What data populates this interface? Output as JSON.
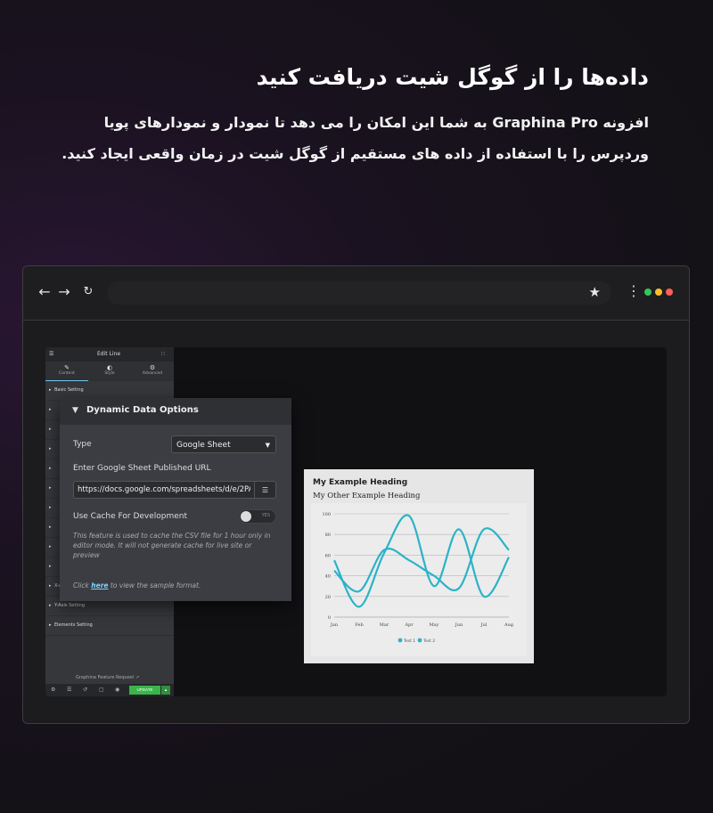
{
  "hero": {
    "title": "داده‌ها را از گوگل شیت دریافت کنید",
    "line1": "افزونه Graphina Pro به شما این امکان را می دهد تا نمودار و نمودارهای پویا",
    "line2": "وردپرس را با استفاده از داده های مستقیم از گوگل شیت در زمان واقعی ایجاد کنید."
  },
  "browser": {
    "url_value": "",
    "dot_colors": [
      "#34c759",
      "#ffbd2e",
      "#ff5f57"
    ]
  },
  "editor": {
    "title": "Edit Line",
    "tabs": [
      {
        "label": "Content",
        "icon": "pencil-icon"
      },
      {
        "label": "Style",
        "icon": "contrast-icon"
      },
      {
        "label": "Advanced",
        "icon": "gear-icon"
      }
    ],
    "sections": [
      "Basic Setting",
      "",
      "",
      "",
      "",
      "",
      "",
      "",
      "",
      "",
      "X-Axis Setting",
      "Y-Axis Setting",
      "Elements Setting"
    ],
    "feature_request": "Graphina Feature Request",
    "update_label": "UPDATE"
  },
  "dynamic": {
    "heading": "Dynamic Data Options",
    "type_label": "Type",
    "type_value": "Google Sheet",
    "url_label": "Enter Google Sheet Published URL",
    "url_value": "https://docs.google.com/spreadsheets/d/e/2PACX",
    "cache_label": "Use Cache For Development",
    "toggle_text": "YES",
    "note": "This feature is used to cache the CSV file for 1 hour only in editor mode. It will not generate cache for live site or preview",
    "click_prefix": "Click",
    "click_link": "here",
    "click_suffix": "to view the sample format."
  },
  "chart_data": {
    "type": "line",
    "title": "My Example Heading",
    "subtitle": "My Other Example Heading",
    "categories": [
      "Jan",
      "Feb",
      "Mar",
      "Apr",
      "May",
      "Jun",
      "Jul",
      "Aug"
    ],
    "ylim": [
      0,
      100
    ],
    "yticks": [
      0,
      20,
      40,
      60,
      80,
      100
    ],
    "grid": true,
    "legend": "bottom",
    "colors": [
      "#2bb3c7",
      "#2bb3c7"
    ],
    "series": [
      {
        "name": "Test 1",
        "values": [
          55,
          10,
          62,
          98,
          30,
          85,
          20,
          58
        ]
      },
      {
        "name": "Test 2",
        "values": [
          45,
          25,
          65,
          55,
          40,
          28,
          85,
          65
        ]
      }
    ]
  }
}
